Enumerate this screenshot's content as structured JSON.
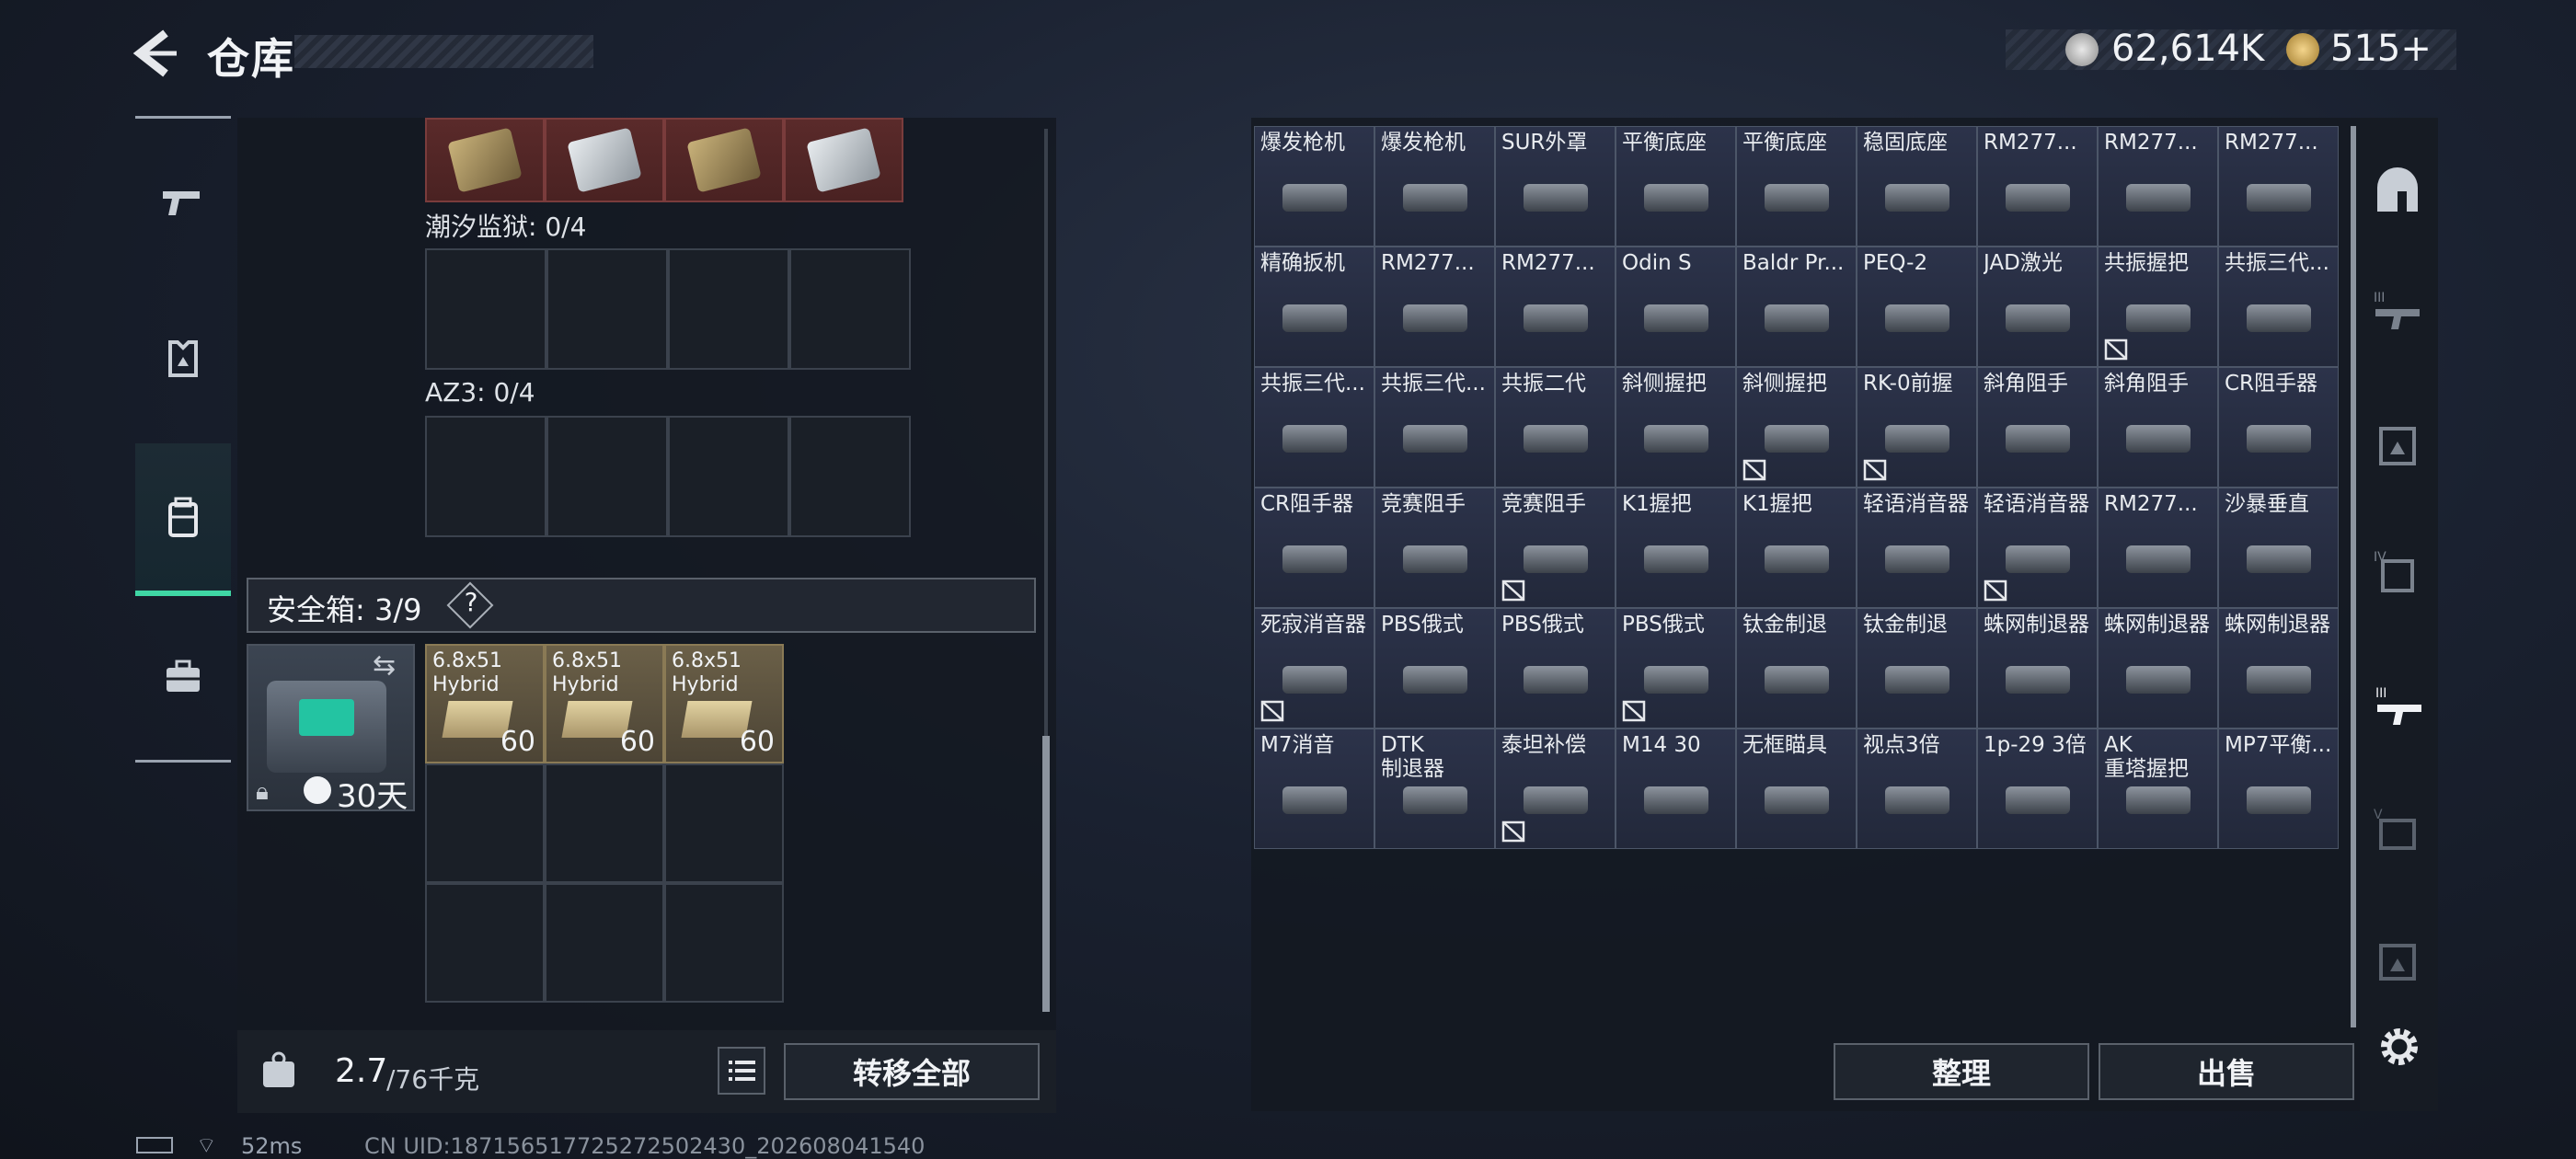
{
  "header": {
    "title": "仓库",
    "silver": "62,614K",
    "gold": "515+"
  },
  "left": {
    "chaoxi_label": "潮汐监狱: 0/4",
    "az3_label": "AZ3: 0/4",
    "safe_label": "安全箱: 3/9",
    "safe_help": "?",
    "safebox_days": "30天",
    "ammo": [
      {
        "name": "6.8x51\nHybrid",
        "count": "60"
      },
      {
        "name": "6.8x51\nHybrid",
        "count": "60"
      },
      {
        "name": "6.8x51\nHybrid",
        "count": "60"
      }
    ],
    "weight_current": "2.7",
    "weight_max": "/76千克",
    "transfer_label": "转移全部"
  },
  "right": {
    "items": [
      {
        "label": "爆发枪机",
        "badge": false
      },
      {
        "label": "爆发枪机",
        "badge": false
      },
      {
        "label": "SUR外罩",
        "badge": false
      },
      {
        "label": "平衡底座",
        "badge": false
      },
      {
        "label": "平衡底座",
        "badge": false
      },
      {
        "label": "稳固底座",
        "badge": false
      },
      {
        "label": "RM277...",
        "badge": false
      },
      {
        "label": "RM277...",
        "badge": false
      },
      {
        "label": "RM277...",
        "badge": false
      },
      {
        "label": "精确扳机",
        "badge": false
      },
      {
        "label": "RM277...",
        "badge": false
      },
      {
        "label": "RM277...",
        "badge": false
      },
      {
        "label": "Odin S",
        "badge": false
      },
      {
        "label": "Baldr Pr...",
        "badge": false
      },
      {
        "label": "PEQ-2",
        "badge": false
      },
      {
        "label": "JAD激光",
        "badge": false
      },
      {
        "label": "共振握把",
        "badge": true
      },
      {
        "label": "共振三代...",
        "badge": false
      },
      {
        "label": "共振三代...",
        "badge": false
      },
      {
        "label": "共振三代...",
        "badge": false
      },
      {
        "label": "共振二代",
        "badge": false
      },
      {
        "label": "斜侧握把",
        "badge": false
      },
      {
        "label": "斜侧握把",
        "badge": true
      },
      {
        "label": "RK-0前握",
        "badge": true
      },
      {
        "label": "斜角阻手",
        "badge": false
      },
      {
        "label": "斜角阻手",
        "badge": false
      },
      {
        "label": "CR阻手器",
        "badge": false
      },
      {
        "label": "CR阻手器",
        "badge": false
      },
      {
        "label": "竞赛阻手",
        "badge": false
      },
      {
        "label": "竞赛阻手",
        "badge": true
      },
      {
        "label": "K1握把",
        "badge": false
      },
      {
        "label": "K1握把",
        "badge": false
      },
      {
        "label": "轻语消音器",
        "badge": false
      },
      {
        "label": "轻语消音器",
        "badge": true
      },
      {
        "label": "RM277...",
        "badge": false
      },
      {
        "label": "沙暴垂直",
        "badge": false
      },
      {
        "label": "死寂消音器",
        "badge": true
      },
      {
        "label": "PBS俄式",
        "badge": false
      },
      {
        "label": "PBS俄式",
        "badge": false
      },
      {
        "label": "PBS俄式",
        "badge": true
      },
      {
        "label": "钛金制退",
        "badge": false
      },
      {
        "label": "钛金制退",
        "badge": false
      },
      {
        "label": "蛛网制退器",
        "badge": false
      },
      {
        "label": "蛛网制退器",
        "badge": false
      },
      {
        "label": "蛛网制退器",
        "badge": false
      },
      {
        "label": "M7消音",
        "badge": false
      },
      {
        "label": "DTK\n制退器",
        "badge": false
      },
      {
        "label": "泰坦补偿",
        "badge": true
      },
      {
        "label": "M14 30",
        "badge": false
      },
      {
        "label": "无框瞄具",
        "badge": false
      },
      {
        "label": "视点3倍",
        "badge": false
      },
      {
        "label": "1p-29 3倍",
        "badge": false
      },
      {
        "label": "AK\n重塔握把",
        "badge": false
      },
      {
        "label": "MP7平衡...",
        "badge": false
      }
    ],
    "tidy_label": "整理",
    "sell_label": "出售"
  },
  "status": {
    "ping": "52ms",
    "uid": "CN UID:18715651772527250243​0_202608041540"
  }
}
